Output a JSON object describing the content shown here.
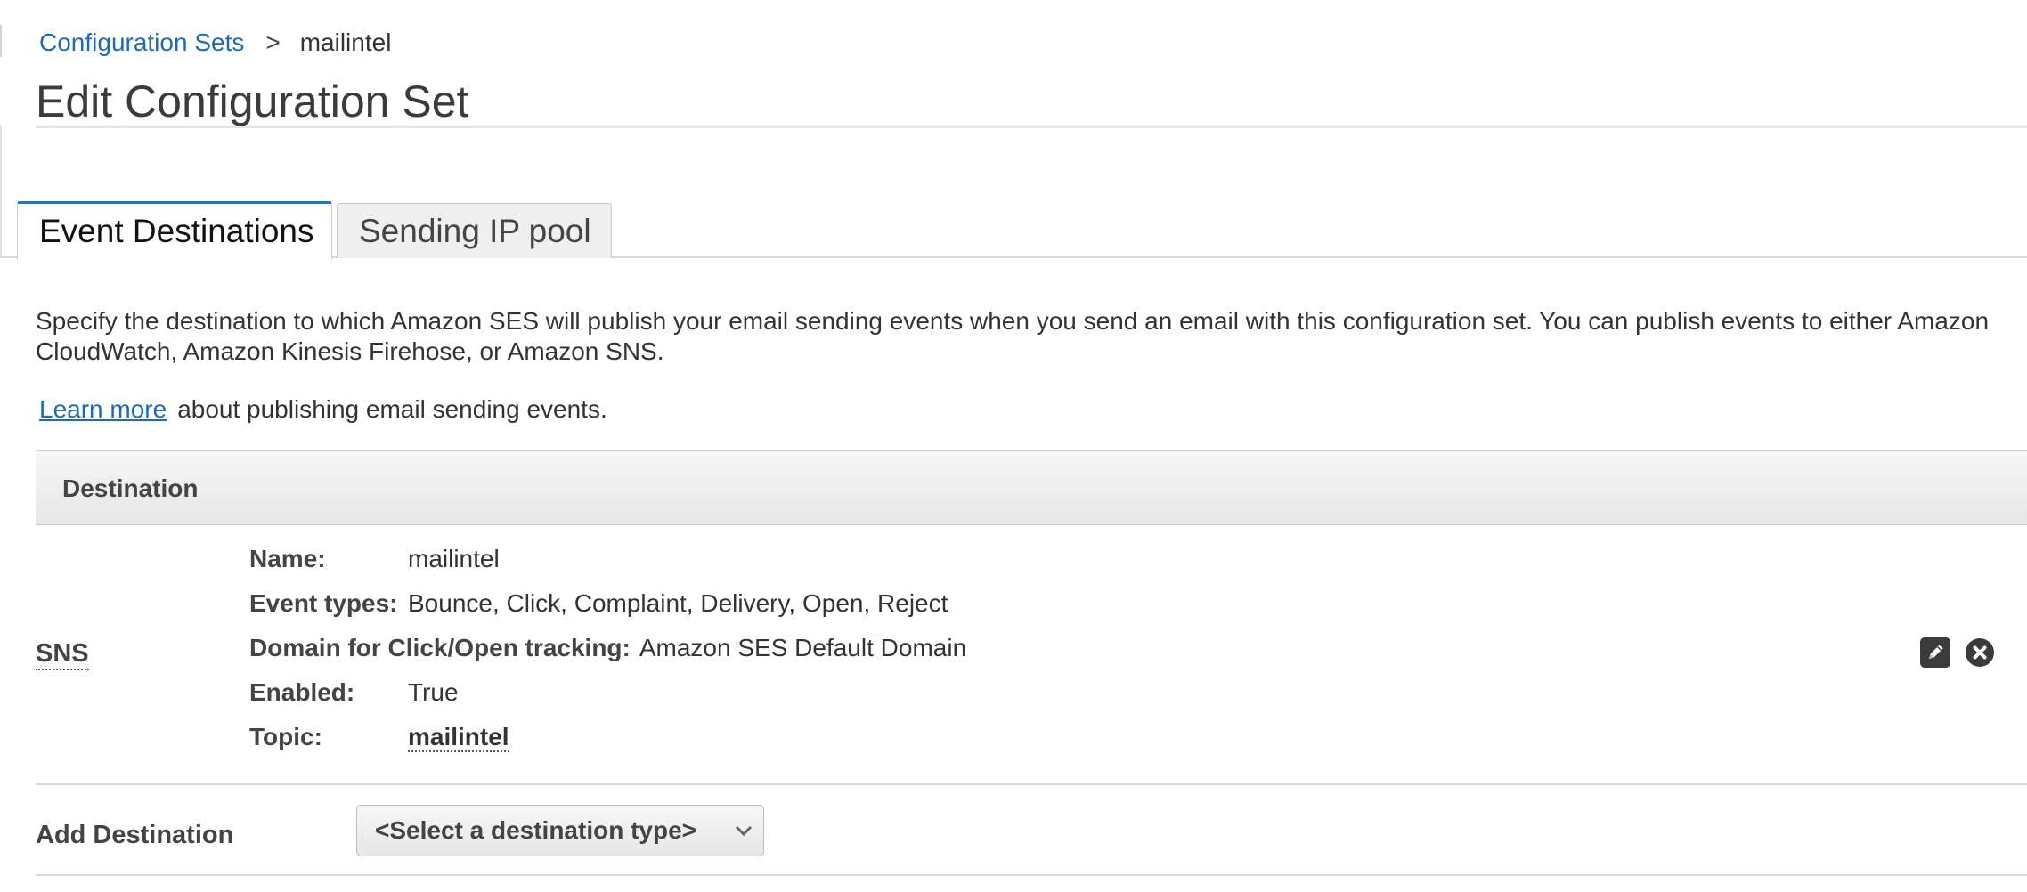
{
  "breadcrumb": {
    "parent": "Configuration Sets",
    "separator": ">",
    "current": "mailintel"
  },
  "page_title": "Edit Configuration Set",
  "tabs": [
    {
      "label": "Event Destinations",
      "active": true
    },
    {
      "label": "Sending IP pool",
      "active": false
    }
  ],
  "description": "Specify the destination to which Amazon SES will publish your email sending events when you send an email with this configuration set. You can publish events to either Amazon CloudWatch, Amazon Kinesis Firehose, or Amazon SNS.",
  "learn_more": {
    "link": "Learn more",
    "text": "about publishing email sending events."
  },
  "destination_table": {
    "header": "Destination",
    "row": {
      "type": "SNS",
      "fields": {
        "name_label": "Name:",
        "name_value": "mailintel",
        "event_types_label": "Event types:",
        "event_types_value": "Bounce, Click, Complaint, Delivery, Open, Reject",
        "domain_label": "Domain for Click/Open tracking:",
        "domain_value": "Amazon SES Default Domain",
        "enabled_label": "Enabled:",
        "enabled_value": "True",
        "topic_label": "Topic:",
        "topic_value": "mailintel"
      },
      "actions": [
        "edit-icon",
        "remove-icon"
      ]
    }
  },
  "add_destination": {
    "label": "Add Destination",
    "select_value": "<Select a destination type>"
  },
  "colors": {
    "link": "#1f6bb3",
    "tab_active_border": "#2a6fc0",
    "icon_bg": "#3b3b3b"
  }
}
